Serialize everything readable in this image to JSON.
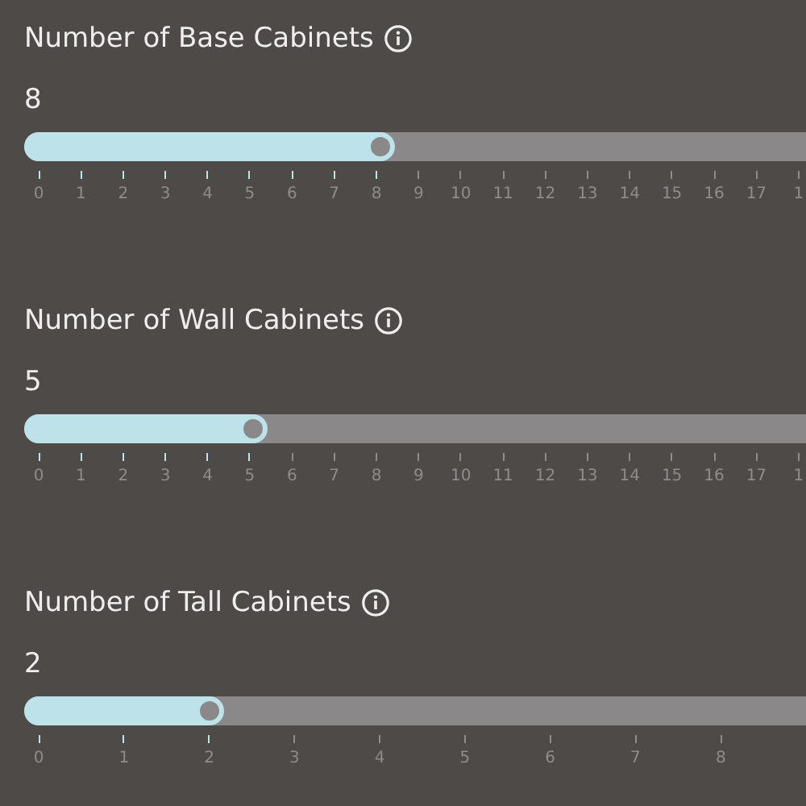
{
  "sliders": [
    {
      "label": "Number of Base Cabinets",
      "value": "8",
      "level": 0.474,
      "kind": "fine",
      "ticks": [
        "0",
        "1",
        "2",
        "3",
        "4",
        "5",
        "6",
        "7",
        "8",
        "9",
        "10",
        "11",
        "12",
        "13",
        "14",
        "15",
        "16",
        "17",
        "1"
      ]
    },
    {
      "label": "Number of Wall Cabinets",
      "value": "5",
      "level": 0.311,
      "kind": "fine",
      "ticks": [
        "0",
        "1",
        "2",
        "3",
        "4",
        "5",
        "6",
        "7",
        "8",
        "9",
        "10",
        "11",
        "12",
        "13",
        "14",
        "15",
        "16",
        "17",
        "1"
      ]
    },
    {
      "label": "Number of Tall Cabinets",
      "value": "2",
      "level": 0.256,
      "kind": "coarse",
      "ticks": [
        "0",
        "1",
        "2",
        "3",
        "4",
        "5",
        "6",
        "7",
        "8"
      ]
    }
  ]
}
